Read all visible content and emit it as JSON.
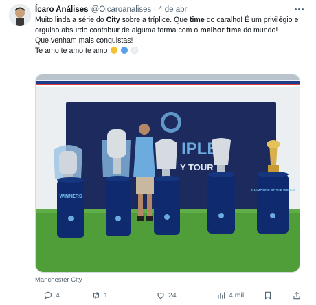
{
  "tweet": {
    "author_name": "Ícaro Análises",
    "handle": "@Oicaroanalises",
    "separator": "·",
    "time": "4 de abr",
    "text": {
      "line1_a": "Muito linda a série do ",
      "line1_b": "City",
      "line1_c": " sobre a tríplice. Que ",
      "line1_d": "time",
      "line1_e": " do caralho! É um privilégio e orgulho absurdo contribuir de alguma forma com o ",
      "line1_f": "melhor time",
      "line1_g": " do mundo!",
      "line2": "Que venham mais conquistas!",
      "line3": "Te amo te amo te amo"
    },
    "media_caption": "Manchester City",
    "media": {
      "backdrop_text_1": "IPLE",
      "backdrop_text_2": "Y TOUR",
      "pedestal_label_1": "WINNERS",
      "pedestal_label_5": "CHAMPIONS OF THE WORLD"
    },
    "stats": {
      "replies": "4",
      "retweets": "1",
      "likes": "24",
      "views": "4 mil"
    }
  },
  "icons": [
    "avatar",
    "more-icon",
    "reply-icon",
    "retweet-icon",
    "like-icon",
    "views-icon",
    "bookmark-icon"
  ],
  "colors": {
    "text": "#0f1419",
    "secondary": "#536471",
    "backdrop": "#1c2a5e",
    "pedestal": "#0f2a6e",
    "grass": "#4f9e3a",
    "emoji_blue": "#5aa0e6"
  }
}
